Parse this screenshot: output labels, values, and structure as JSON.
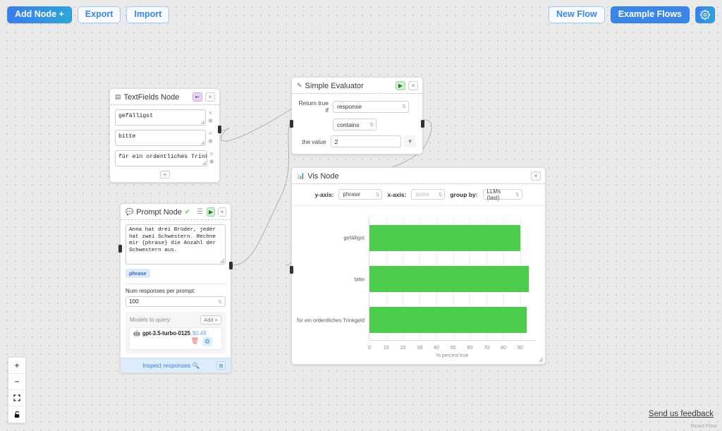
{
  "toolbar_left": {
    "add_node": "Add Node +",
    "export": "Export",
    "import": "Import"
  },
  "toolbar_right": {
    "new_flow": "New Flow",
    "example_flows": "Example Flows",
    "settings_icon": "gear-icon"
  },
  "textfields_node": {
    "title": "TextFields Node",
    "icon": "textfields-icon",
    "fields": [
      {
        "value": "gefälligst"
      },
      {
        "value": "bitte"
      },
      {
        "value": "für ein ordentliches Trinkgeld"
      }
    ],
    "add_label": "+",
    "close_label": "×",
    "badge_label": "⇤"
  },
  "evaluator_node": {
    "title": "Simple Evaluator",
    "icon": "pencil-icon",
    "run_label": "▶",
    "close_label": "×",
    "rows": {
      "return_true_if_label": "Return true if",
      "variable_value": "response",
      "operator_value": "contains",
      "the_value_label": "the value",
      "the_value": "2",
      "caret_icon": "chevron-down-icon"
    }
  },
  "prompt_node": {
    "title": "Prompt Node",
    "icon": "chat-icon",
    "check_icon": "green-check-icon",
    "list_icon": "list-icon",
    "run_label": "▶",
    "close_label": "×",
    "prompt_text": "Anna hat drei Brüder, jeder hat zwei Schwestern. Rechne mir {phrase} die Anzahl der Schwestern aus.",
    "variable_chip": "phrase",
    "num_responses_label": "Num responses per prompt:",
    "num_responses_value": "100",
    "models_label": "Models to query:",
    "add_model_label": "Add +",
    "model": {
      "icon": "openai-icon",
      "name": "gpt-3.5-turbo-0125",
      "cost": "$0.49",
      "delete_icon": "trash-icon",
      "settings_icon": "gear-icon"
    },
    "inspect_label": "Inspect responses",
    "inspect_icon": "magnifier-icon",
    "expand_icon": "expand-icon"
  },
  "vis_node": {
    "title": "Vis Node",
    "icon": "barchart-icon",
    "close_label": "×",
    "controls": {
      "y_axis_label": "y-axis:",
      "y_axis_value": "phrase",
      "x_axis_label": "x-axis:",
      "x_axis_value": "score",
      "group_by_label": "group by:",
      "group_by_value": "LLMs (last)"
    }
  },
  "chart_data": {
    "type": "bar",
    "orientation": "horizontal",
    "title": "",
    "categories": [
      "gefälligst",
      "bitte",
      "für ein ordentliches Trinkgeld"
    ],
    "values": [
      90,
      95,
      94
    ],
    "series": [
      {
        "name": "gpt-3.5-turbo-0125",
        "values": [
          90,
          95,
          94
        ]
      }
    ],
    "xlabel": "% percent true",
    "ylabel": "",
    "xticks": [
      0,
      10,
      20,
      30,
      40,
      50,
      60,
      70,
      80,
      90
    ],
    "xlim": [
      0,
      99
    ],
    "grid": true,
    "legend": false,
    "bar_color": "#4bcc4b"
  },
  "zoom_controls": {
    "zoom_in": "+",
    "zoom_out": "−",
    "fit_view": "fit-view-icon",
    "lock": "lock-icon"
  },
  "footer": {
    "feedback": "Send us feedback",
    "attribution": "React Flow"
  },
  "colors": {
    "accent": "#3b87e8",
    "bar_green": "#4bcc4b",
    "canvas": "#eaeaea"
  }
}
